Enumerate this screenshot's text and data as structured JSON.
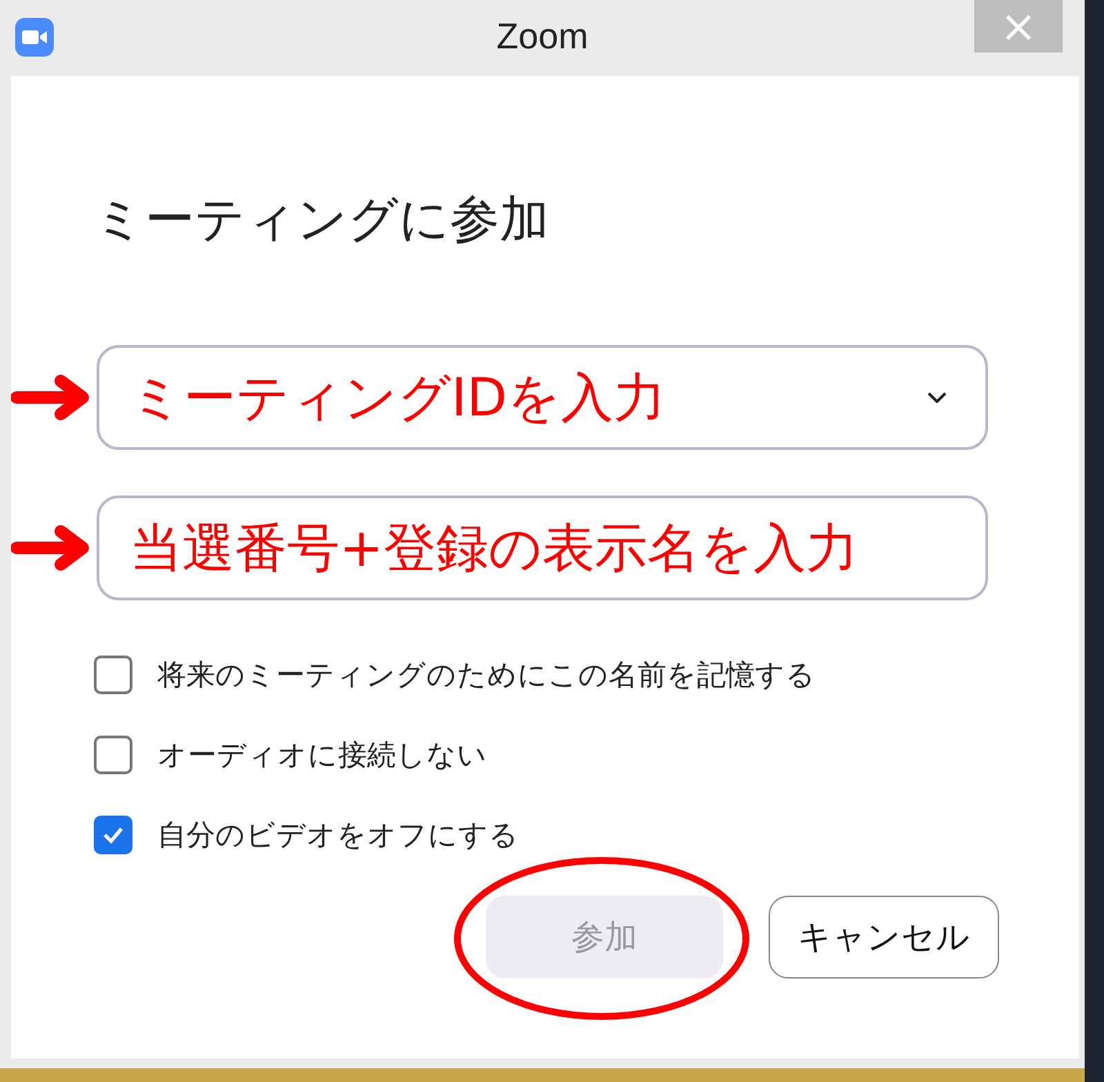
{
  "window": {
    "title": "Zoom",
    "close": "×"
  },
  "heading": "ミーティングに参加",
  "fields": [
    {
      "kind": "dropdown",
      "value": "ミーティングIDを入力",
      "arrow": true
    },
    {
      "kind": "text",
      "value": "当選番号+登録の表示名を入力",
      "arrow": true
    }
  ],
  "options": [
    {
      "label": "将来のミーティングのためにこの名前を記憶する",
      "checked": false
    },
    {
      "label": "オーディオに接続しない",
      "checked": false
    },
    {
      "label": "自分のビデオをオフにする",
      "checked": true
    }
  ],
  "buttons": [
    {
      "label": "参加",
      "disabled": true,
      "circled": true
    },
    {
      "label": "キャンセル",
      "disabled": false,
      "circled": false
    }
  ]
}
